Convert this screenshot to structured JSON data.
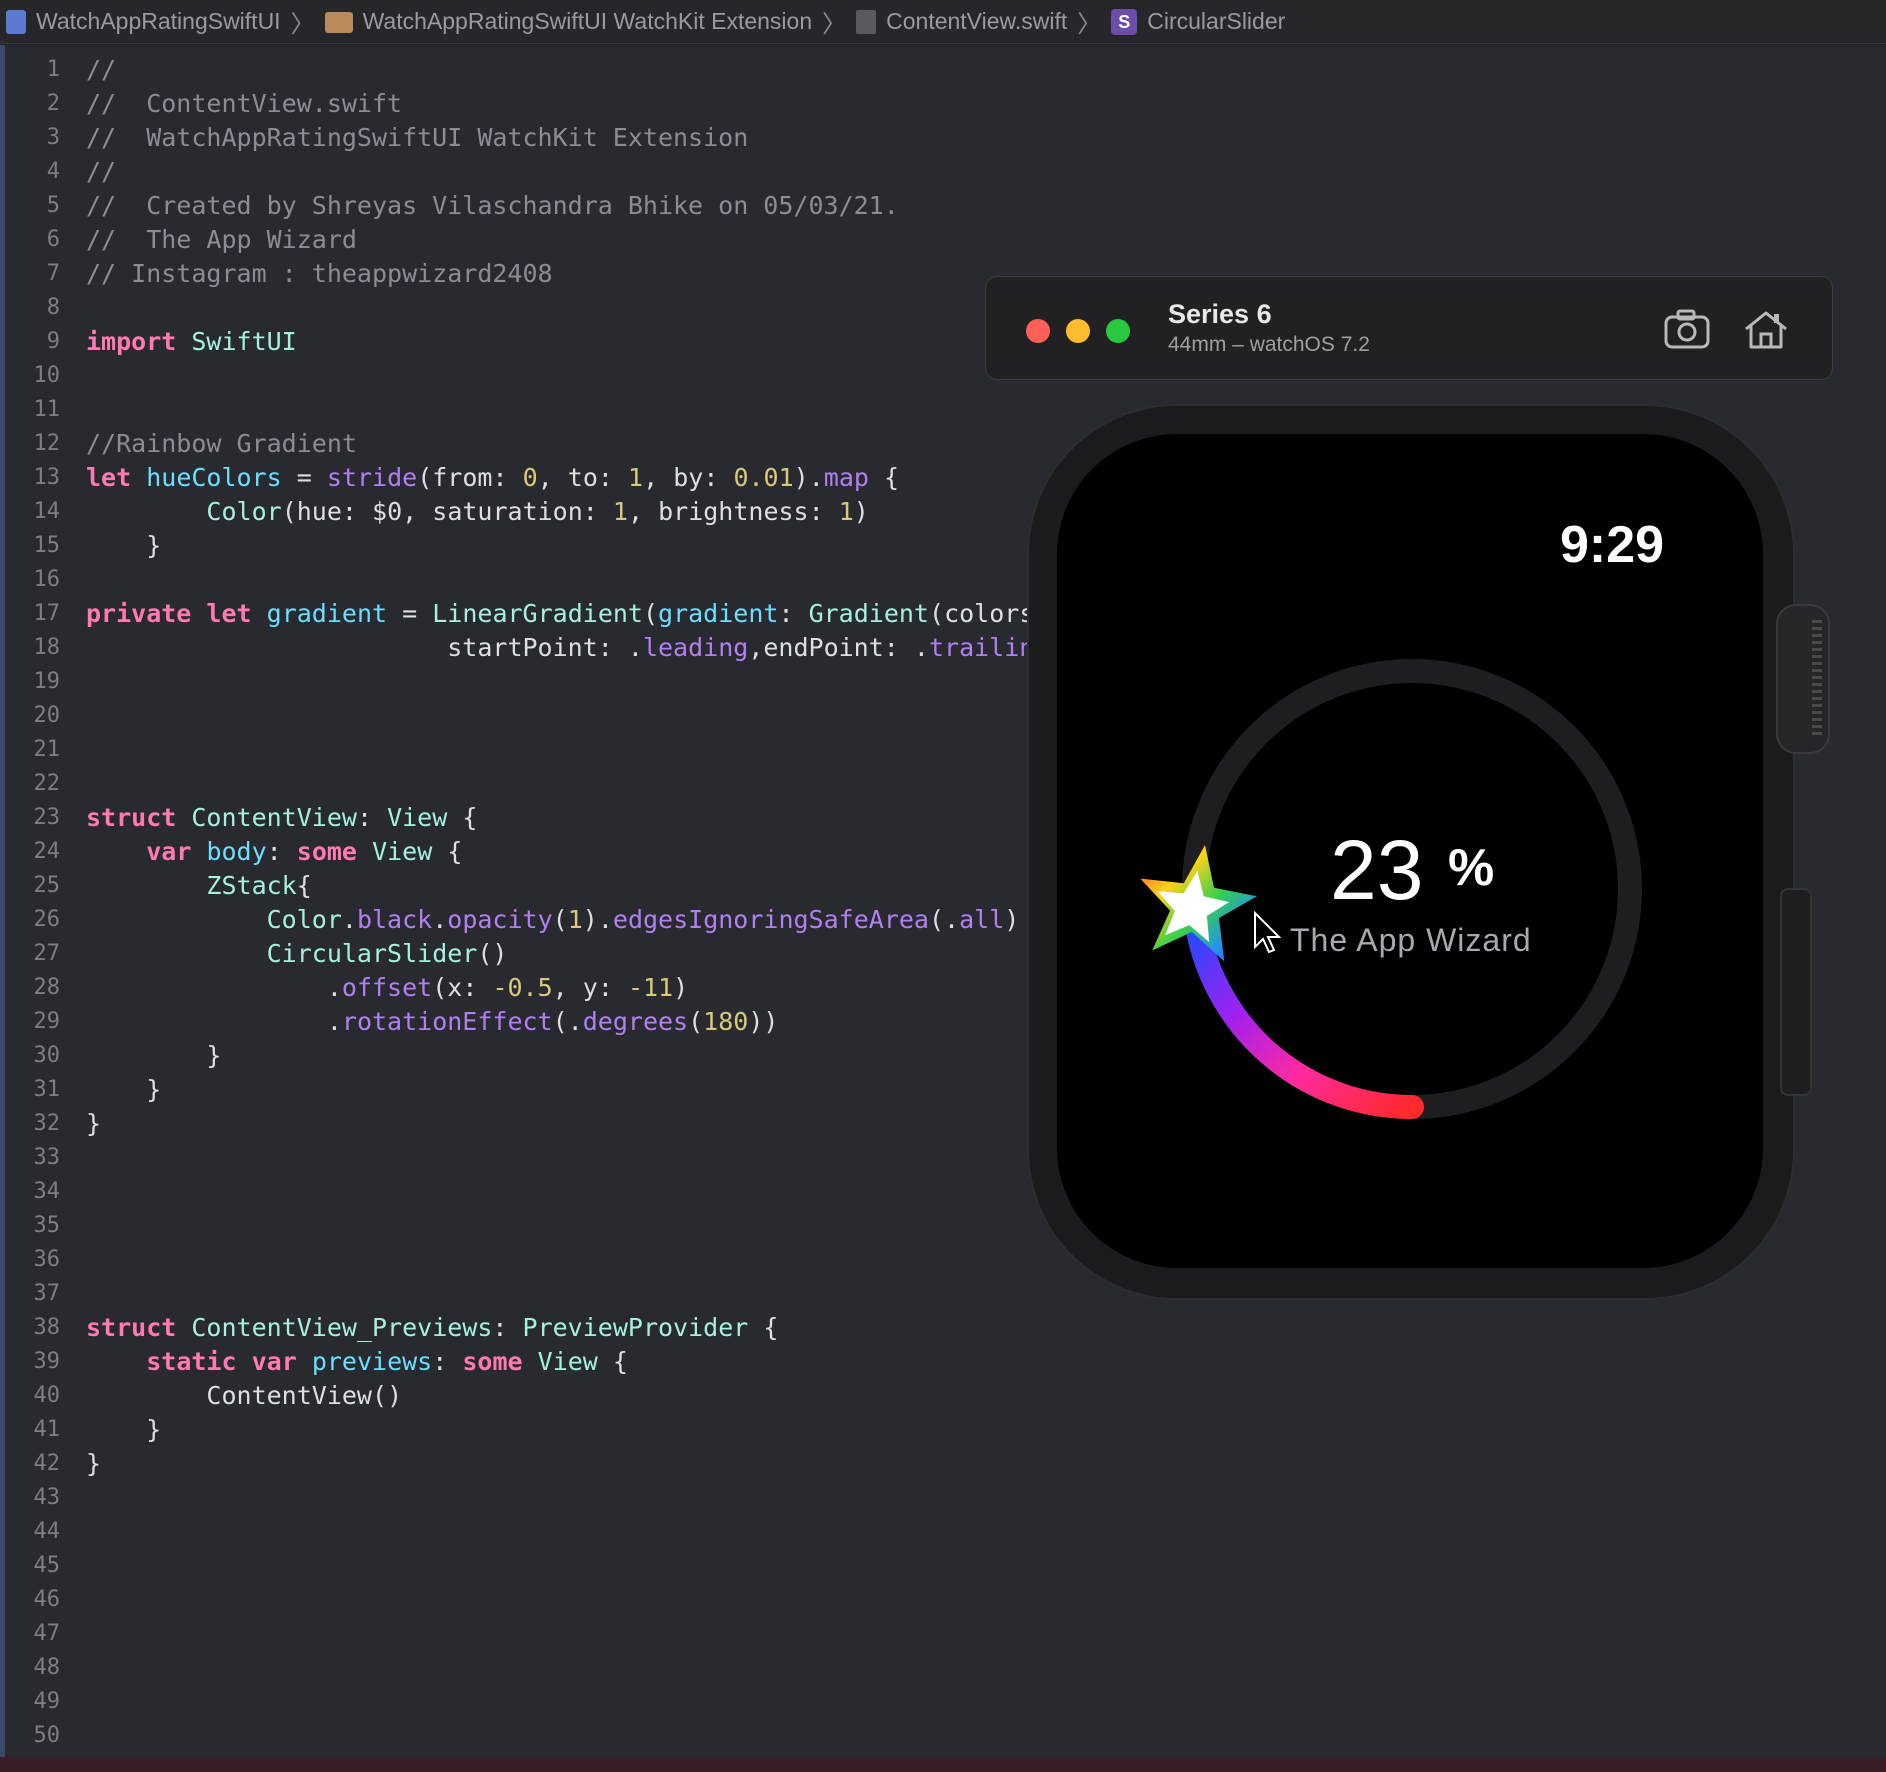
{
  "breadcrumb": {
    "project": "WatchAppRatingSwiftUI",
    "folder": "WatchAppRatingSwiftUI WatchKit Extension",
    "file": "ContentView.swift",
    "symbol_badge": "S",
    "symbol": "CircularSlider"
  },
  "code": {
    "lines": [
      {
        "n": "1",
        "t": "//"
      },
      {
        "n": "2",
        "t": "//  ContentView.swift"
      },
      {
        "n": "3",
        "t": "//  WatchAppRatingSwiftUI WatchKit Extension"
      },
      {
        "n": "4",
        "t": "//"
      },
      {
        "n": "5",
        "t": "//  Created by Shreyas Vilaschandra Bhike on 05/03/21."
      },
      {
        "n": "6",
        "t": "//  The App Wizard"
      },
      {
        "n": "7",
        "t": "// Instagram : theappwizard2408"
      },
      {
        "n": "8",
        "t": ""
      },
      {
        "n": "9",
        "t": "import SwiftUI"
      },
      {
        "n": "10",
        "t": ""
      },
      {
        "n": "11",
        "t": ""
      },
      {
        "n": "12",
        "t": "//Rainbow Gradient"
      },
      {
        "n": "13",
        "t": "let hueColors = stride(from: 0, to: 1, by: 0.01).map {"
      },
      {
        "n": "14",
        "t": "        Color(hue: $0, saturation: 1, brightness: 1)"
      },
      {
        "n": "15",
        "t": "    }"
      },
      {
        "n": "16",
        "t": ""
      },
      {
        "n": "17",
        "t": "private let gradient = LinearGradient(gradient: Gradient(colors:"
      },
      {
        "n": "18",
        "t": "                        startPoint: .leading,endPoint: .trailing"
      },
      {
        "n": "19",
        "t": ""
      },
      {
        "n": "20",
        "t": ""
      },
      {
        "n": "21",
        "t": ""
      },
      {
        "n": "22",
        "t": ""
      },
      {
        "n": "23",
        "t": "struct ContentView: View {"
      },
      {
        "n": "24",
        "t": "    var body: some View {"
      },
      {
        "n": "25",
        "t": "        ZStack{"
      },
      {
        "n": "26",
        "t": "            Color.black.opacity(1).edgesIgnoringSafeArea(.all)"
      },
      {
        "n": "27",
        "t": "            CircularSlider()"
      },
      {
        "n": "28",
        "t": "                .offset(x: -0.5, y: -11)"
      },
      {
        "n": "29",
        "t": "                .rotationEffect(.degrees(180))"
      },
      {
        "n": "30",
        "t": "        }"
      },
      {
        "n": "31",
        "t": "    }"
      },
      {
        "n": "32",
        "t": "}"
      },
      {
        "n": "33",
        "t": ""
      },
      {
        "n": "34",
        "t": ""
      },
      {
        "n": "35",
        "t": ""
      },
      {
        "n": "36",
        "t": ""
      },
      {
        "n": "37",
        "t": ""
      },
      {
        "n": "38",
        "t": "struct ContentView_Previews: PreviewProvider {"
      },
      {
        "n": "39",
        "t": "    static var previews: some View {"
      },
      {
        "n": "40",
        "t": "        ContentView()"
      },
      {
        "n": "41",
        "t": "    }"
      },
      {
        "n": "42",
        "t": "}"
      },
      {
        "n": "43",
        "t": ""
      },
      {
        "n": "44",
        "t": ""
      },
      {
        "n": "45",
        "t": ""
      },
      {
        "n": "46",
        "t": ""
      },
      {
        "n": "47",
        "t": ""
      },
      {
        "n": "48",
        "t": ""
      },
      {
        "n": "49",
        "t": ""
      },
      {
        "n": "50",
        "t": ""
      }
    ]
  },
  "simulator": {
    "device_name": "Series 6",
    "device_subtitle": "44mm – watchOS 7.2",
    "screenshot_icon": "camera-icon",
    "home_icon": "home-icon"
  },
  "watch": {
    "time": "9:29",
    "percent_value": "23",
    "percent_sign": "%",
    "caption": "The App Wizard",
    "progress_fraction": 0.23,
    "track_color": "#1e1e20",
    "knob_icon": "star-icon"
  },
  "colors": {
    "keyword": "#ff7ab2",
    "type": "#a6f0e0",
    "function": "#b180f0",
    "number": "#d9c97c",
    "comment": "#8a8d94"
  }
}
